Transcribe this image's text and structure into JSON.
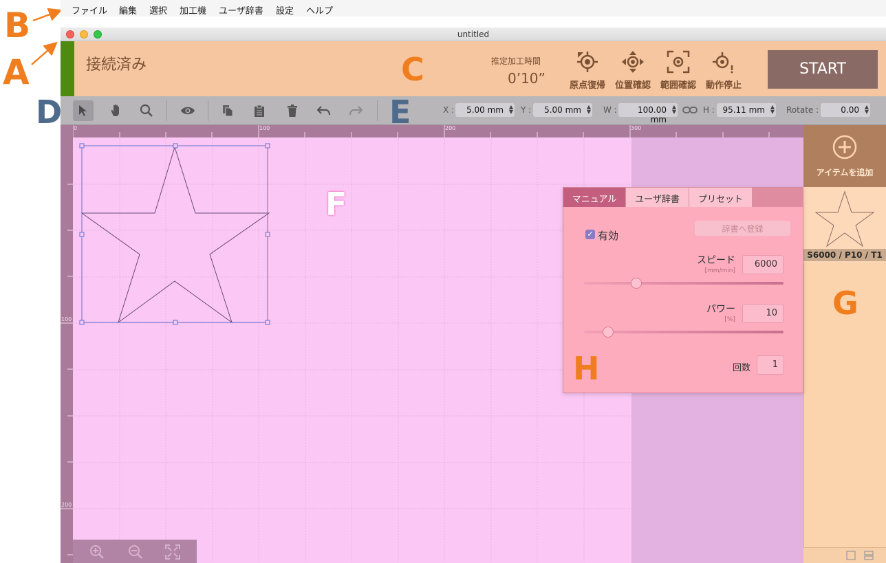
{
  "callouts": {
    "a": "A",
    "b": "B",
    "c": "C",
    "d": "D",
    "e": "E",
    "f": "F",
    "g": "G",
    "h": "H"
  },
  "menu": [
    "ファイル",
    "編集",
    "選択",
    "加工機",
    "ユーザ辞書",
    "設定",
    "ヘルプ"
  ],
  "window": {
    "title": "untitled"
  },
  "header": {
    "status": "接続済み",
    "estimate_label": "推定加工時間",
    "estimate_value": "0’10”",
    "buttons": [
      "原点復帰",
      "位置確認",
      "範囲確認",
      "動作停止"
    ],
    "start": "START"
  },
  "toolbar": {
    "x_label": "X :",
    "x_value": "5.00 mm",
    "y_label": "Y :",
    "y_value": "5.00 mm",
    "w_label": "W :",
    "w_value": "100.00 mm",
    "h_label": "H :",
    "h_value": "95.11 mm",
    "rotate_label": "Rotate :",
    "rotate_value": "0.00"
  },
  "ruler": {
    "top": [
      "0",
      "100",
      "200",
      "300"
    ],
    "left": [
      "100",
      "200"
    ]
  },
  "sidebar": {
    "add_label": "アイテムを追加",
    "item_label": "S6000 / P10 / T1"
  },
  "panel": {
    "tabs": [
      "マニュアル",
      "ユーザ辞書",
      "プリセット"
    ],
    "enabled_label": "有効",
    "register_button": "辞書へ登録",
    "speed_label": "スピード",
    "speed_unit": "[mm/min]",
    "speed_value": "6000",
    "power_label": "パワー",
    "power_unit": "[%]",
    "power_value": "10",
    "count_label": "回数",
    "count_value": "1"
  },
  "colors": {
    "header": "#f5c6a0",
    "canvas": "#fbc8f5",
    "sidebar": "#fbd3ac",
    "panel": "#fdacbe",
    "connected": "#4f8a10"
  }
}
